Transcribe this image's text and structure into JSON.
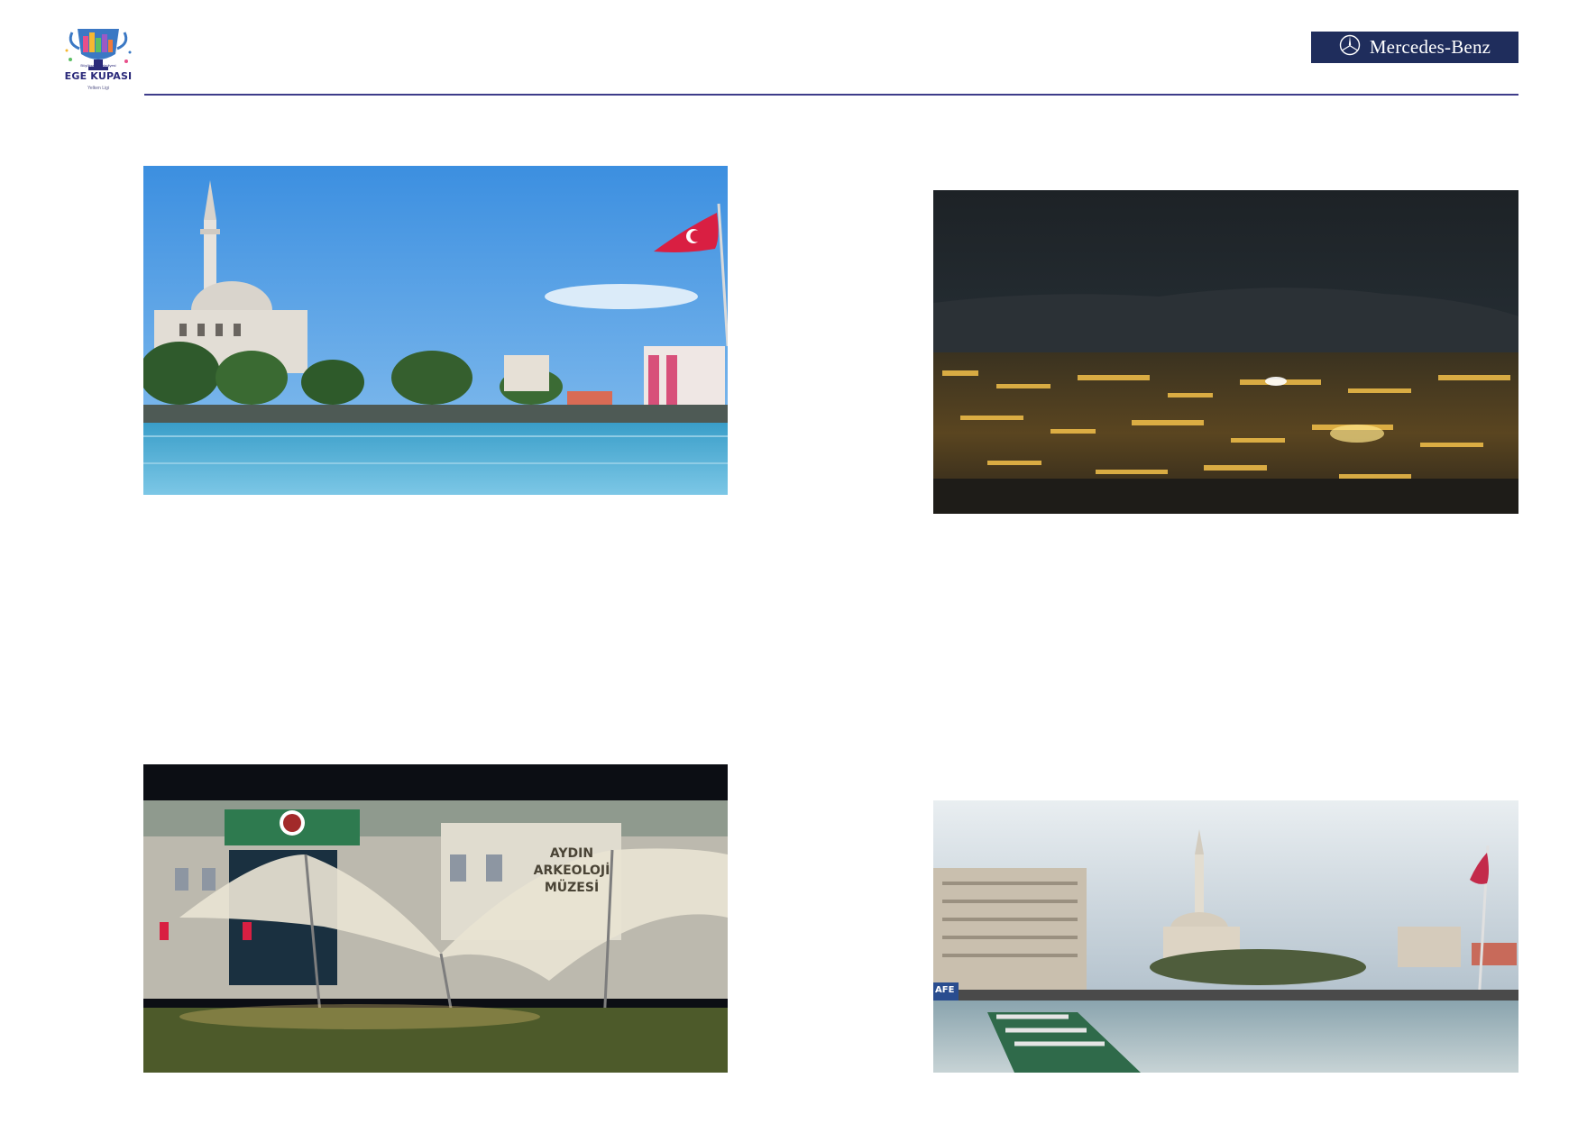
{
  "header": {
    "logo": {
      "top_text": "Büyükşehir Belediyesi",
      "title": "EGE KUPASI",
      "sub_text": "Yelken Ligi"
    },
    "brand": {
      "name": "Mercedes-Benz",
      "icon": "mercedes-star-icon",
      "bg_color": "#1f2d5c"
    },
    "rule_color": "#3e3c8a"
  },
  "photos": {
    "mosque_pool": {
      "subject": "mosque-with-pool-and-flag-photo"
    },
    "city_night": {
      "subject": "city-lights-at-night-photo"
    },
    "museum": {
      "sign": [
        "AYDIN",
        "ARKEOLOJİ",
        "MÜZESİ"
      ]
    },
    "square": {
      "shop_sign": "AFE"
    }
  }
}
